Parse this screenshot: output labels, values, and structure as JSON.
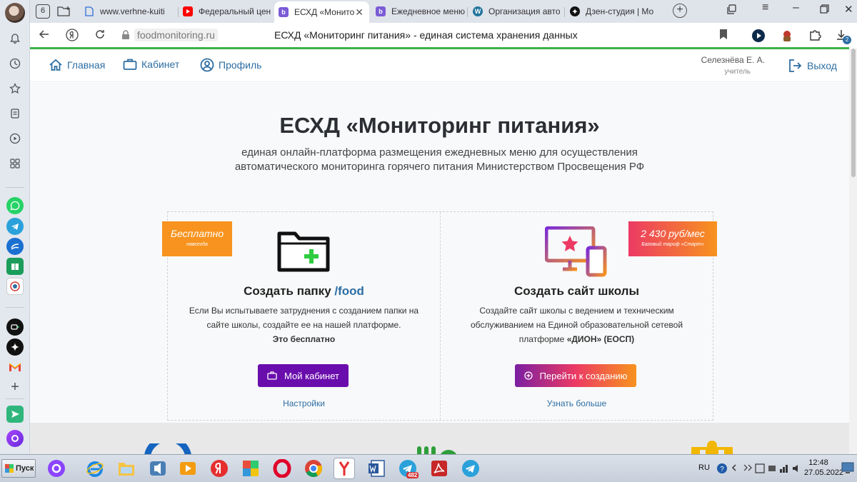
{
  "tabs": [
    {
      "title": "www.verhne-kuiti",
      "color": "#2f6fd6",
      "icon": "page-icon"
    },
    {
      "title": "Федеральный цен",
      "color": "#ff0000",
      "icon": "youtube-icon"
    },
    {
      "title": "ЕСХД «Монитор",
      "color": "#7b5cd6",
      "icon": "b-icon",
      "active": true
    },
    {
      "title": "Ежедневное меню",
      "color": "#7b5cd6",
      "icon": "b-icon"
    },
    {
      "title": "Организация авто",
      "color": "#21759b",
      "icon": "wordpress-icon"
    },
    {
      "title": "Дзен-студия | Мо",
      "color": "#111111",
      "icon": "zen-icon"
    }
  ],
  "addressbar": {
    "url": "foodmonitoring.ru",
    "page_title": "ЕСХД «Мониторинг питания» - единая система хранения данных",
    "downloads_count": "2"
  },
  "site": {
    "nav": [
      {
        "label": "Главная",
        "icon": "home-icon"
      },
      {
        "label": "Кабинет",
        "icon": "briefcase-icon"
      },
      {
        "label": "Профиль",
        "icon": "user-icon"
      }
    ],
    "user_name": "Селезнёва Е. А.",
    "user_role": "учитель",
    "logout_label": "Выход",
    "title": "ЕСХД «Мониторинг питания»",
    "subtitle_line1": "единая онлайн-платформа размещения ежедневных меню для осуществления",
    "subtitle_line2": "автоматического мониторинга горячего питания Министерством Просвещения РФ",
    "card_left": {
      "badge_main": "Бесплатно",
      "badge_sub": "навсегда",
      "title_main": "Создать папку",
      "title_accent": "/food",
      "text_line1": "Если Вы испытываете затруднения с созданием папки на",
      "text_line2": "сайте школы, создайте ее на нашей платформе.",
      "text_bold": "Это бесплатно",
      "button_label": "Мой кабинет",
      "link_label": "Настройки"
    },
    "card_right": {
      "badge_main": "2 430 руб/мес",
      "badge_sub": "Базовый тариф «Старт»",
      "title": "Создать сайт школы",
      "text_line1": "Создайте сайт школы с ведением и техническим",
      "text_line2": "обслуживанием на Единой образовательной сетевой",
      "text_line3_prefix": "платформе",
      "text_line3_bold": "«ДИОН» (ЕОСП)",
      "button_label": "Перейти к созданию",
      "link_label": "Узнать больше"
    }
  },
  "taskbar": {
    "start_label": "Пуск",
    "lang": "RU",
    "time": "12:48",
    "date": "27.05.2022",
    "telegram_badge": "482"
  },
  "colors": {
    "accent_blue": "#2d6ea3",
    "badge_orange": "#f7931e",
    "button_purple": "#6a0dad",
    "browser_green": "#3cb14a"
  }
}
